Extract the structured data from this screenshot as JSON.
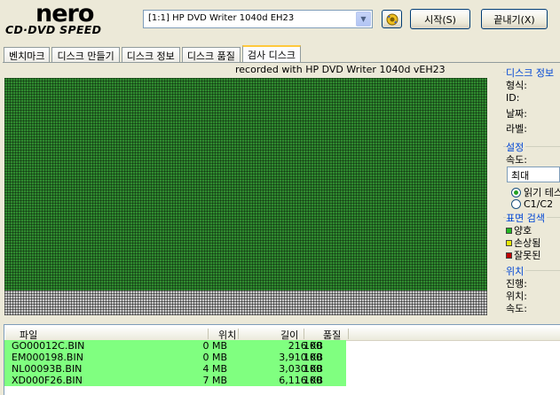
{
  "logo": {
    "brand": "nero",
    "product": "CD·DVD SPEED"
  },
  "toolbar": {
    "drive": "[1:1]  HP DVD Writer 1040d EH23",
    "refresh_icon": "refresh-icon",
    "start_label": "시작(S)",
    "close_label": "끝내기(X)"
  },
  "tabs": [
    {
      "label": "벤치마크"
    },
    {
      "label": "디스크 만들기"
    },
    {
      "label": "디스크 정보"
    },
    {
      "label": "디스크 품질"
    },
    {
      "label": "검사 디스크"
    }
  ],
  "header_text": "recorded with HP      DVD Writer 1040d vEH23",
  "side": {
    "disc_info": {
      "title": "디스크 정보",
      "format_label": "형식:",
      "id_label": "ID:",
      "date_label": "날짜:",
      "label_label": "라벨:"
    },
    "settings": {
      "title": "설정",
      "speed_label": "속도:",
      "speed_value": "최대",
      "radio_read": "읽기 테스트",
      "radio_c1c2": "C1/C2"
    },
    "surface_scan": {
      "title": "표면 검색",
      "good": "양호",
      "damaged": "손상됨",
      "bad": "잘못된",
      "colors": {
        "good": "#22b822",
        "damaged": "#e8e800",
        "bad": "#c00000"
      }
    },
    "position": {
      "title": "위치",
      "progress_label": "진행:",
      "position_label": "위치:",
      "speed_label": "속도:"
    }
  },
  "file_list": {
    "columns": [
      "파일",
      "위치",
      "길이",
      "품질"
    ],
    "rows": [
      {
        "file": "GO00012C.BIN",
        "position": "0 MB",
        "length": "216 KB",
        "quality": "100"
      },
      {
        "file": "EM000198.BIN",
        "position": "0 MB",
        "length": "3,910 KB",
        "quality": "100"
      },
      {
        "file": "NL00093B.BIN",
        "position": "4 MB",
        "length": "3,030 KB",
        "quality": "100"
      },
      {
        "file": "XD000F26.BIN",
        "position": "7 MB",
        "length": "6,116 KB",
        "quality": "100"
      }
    ]
  },
  "colors": {
    "grid_good": "#2f8a2f",
    "grid_unread": "#c8c8c8",
    "row_ok": "#80ff80",
    "group_title": "#0046d5"
  }
}
